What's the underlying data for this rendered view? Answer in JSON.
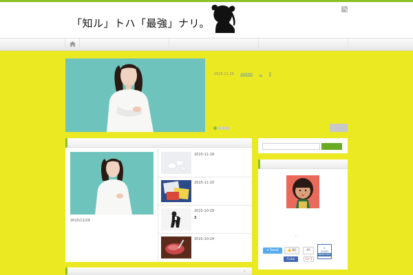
{
  "header": {
    "site_title": "「知ル」トハ「最強」ナリ。",
    "logo_icon": "woman-silhouette-icon",
    "rss_icon": "rss-icon"
  },
  "nav": {
    "home_icon": "home-icon"
  },
  "slider": {
    "date": "2015.11.29",
    "author": "yesnos",
    "category": "...",
    "comments": "0"
  },
  "featured": {
    "date": "2015/11/29",
    "rows": [
      {
        "date": "2015-11-18",
        "title": ""
      },
      {
        "date": "2015-11-10",
        "title": ""
      },
      {
        "date": "2015-10-29",
        "title": "3"
      },
      {
        "date": "2015-10-24",
        "title": ""
      }
    ]
  },
  "sidebar": {
    "profile_caption": "。",
    "share": {
      "tweet": "Tweet",
      "like_count": "82",
      "count": "45",
      "buffer_count": "6",
      "buffer_unit": "USERS",
      "buffer_label": "Bookmark",
      "fb_like": "Like",
      "gplus": "G+1"
    }
  },
  "colors": {
    "background": "#ebe922",
    "accent": "#8cbf26",
    "link": "#5c8fbf"
  }
}
